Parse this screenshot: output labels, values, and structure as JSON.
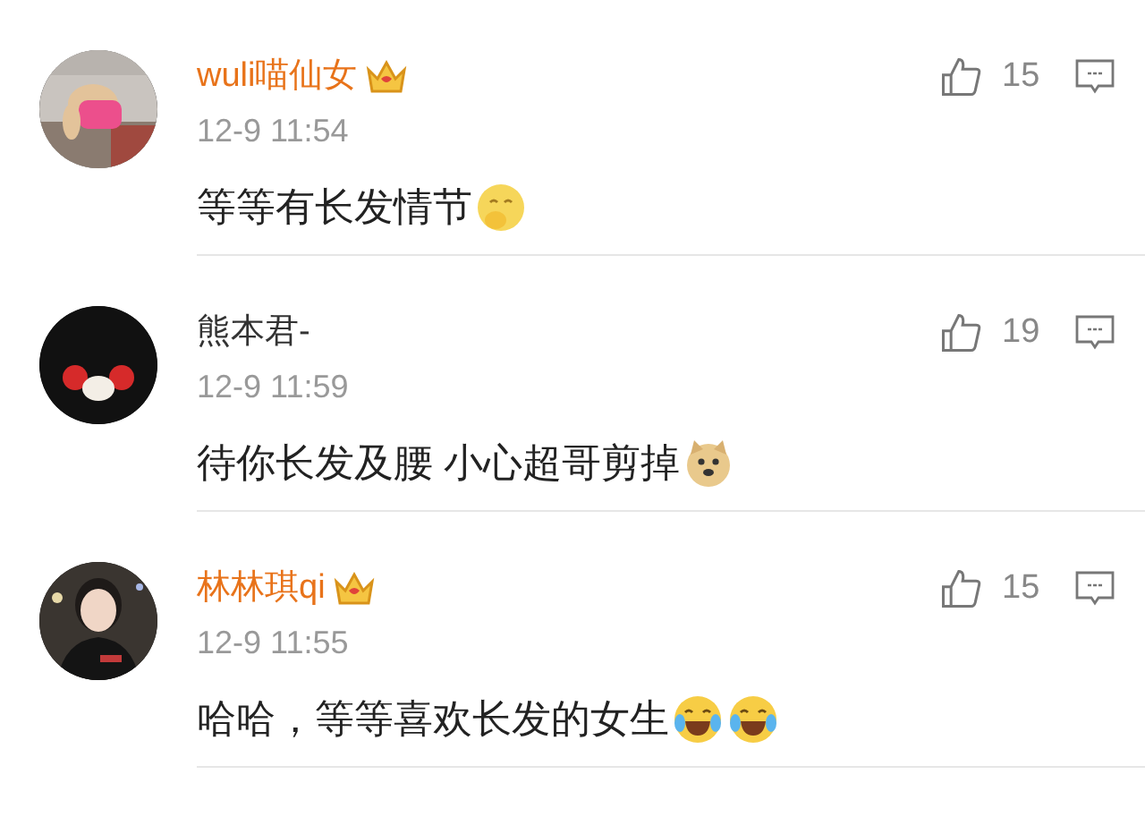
{
  "comments": [
    {
      "name": "wuli喵仙女",
      "vip": true,
      "time": "12-9 11:54",
      "text": "等等有长发情节",
      "emojis": [
        {
          "kind": "thinking"
        }
      ],
      "likes": "15",
      "avatar": {
        "kind": "picture"
      }
    },
    {
      "name": "熊本君-",
      "vip": false,
      "time": "12-9 11:59",
      "text": "待你长发及腰 小心超哥剪掉",
      "emojis": [
        {
          "kind": "doge"
        }
      ],
      "likes": "19",
      "avatar": {
        "kind": "plain"
      }
    },
    {
      "name": "林林琪qi",
      "vip": true,
      "time": "12-9 11:55",
      "text": "哈哈，等等喜欢长发的女生",
      "emojis": [
        {
          "kind": "laughing"
        },
        {
          "kind": "laughing"
        }
      ],
      "likes": "15",
      "avatar": {
        "kind": "picture"
      }
    }
  ]
}
